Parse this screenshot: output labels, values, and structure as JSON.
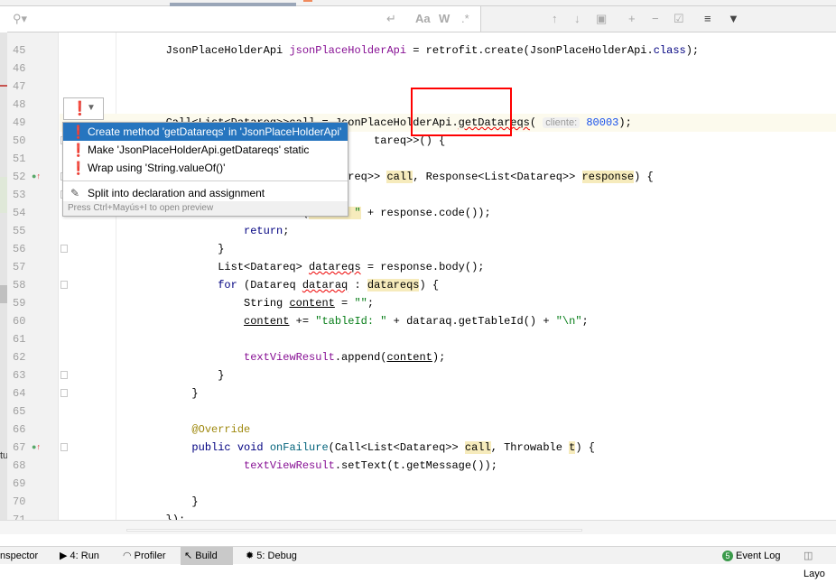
{
  "editor": {
    "lines": [
      {
        "n": "45",
        "segs": [
          [
            "        JsonPlaceHolderApi ",
            ""
          ],
          [
            "jsonPlaceHolderApi",
            "fld"
          ],
          [
            " = retrofit.create(JsonPlaceHolderApi.",
            ""
          ],
          [
            "class",
            "kw"
          ],
          [
            ");",
            ""
          ]
        ]
      },
      {
        "n": "46",
        "segs": []
      },
      {
        "n": "47",
        "segs": []
      },
      {
        "n": "48",
        "segs": []
      },
      {
        "n": "49",
        "cur": true,
        "segs": [
          [
            "        Call<List<Datareq>>call = JsonPlaceHolderApi.",
            ""
          ],
          [
            "getDatareqs",
            "err"
          ],
          [
            "( ",
            ""
          ],
          [
            "cliente:",
            "hint"
          ],
          [
            " ",
            ""
          ],
          [
            "80003",
            "num"
          ],
          [
            ");",
            ""
          ]
        ]
      },
      {
        "n": "50",
        "segs": [
          [
            "                                        tareq>>() {",
            ""
          ]
        ]
      },
      {
        "n": "51",
        "segs": []
      },
      {
        "n": "52",
        "segs": [
          [
            "                            ist<Datareq>> ",
            ""
          ],
          [
            "call",
            "hl"
          ],
          [
            ", Response<List<Datareq>> ",
            ""
          ],
          [
            "response",
            "hl"
          ],
          [
            ") {",
            ""
          ]
        ]
      },
      {
        "n": "53",
        "segs": [
          [
            "                            l()) {",
            ""
          ]
        ]
      },
      {
        "n": "54",
        "segs": [
          [
            "                            t(",
            ""
          ],
          [
            "\"Code: \"",
            "str hl"
          ],
          [
            " + response.code());",
            ""
          ]
        ]
      },
      {
        "n": "55",
        "segs": [
          [
            "                    ",
            ""
          ],
          [
            "return",
            "kw"
          ],
          [
            ";",
            ""
          ]
        ]
      },
      {
        "n": "56",
        "segs": [
          [
            "                }",
            ""
          ]
        ]
      },
      {
        "n": "57",
        "segs": [
          [
            "                List<Datareq> ",
            ""
          ],
          [
            "datareqs",
            "err"
          ],
          [
            " = response.body();",
            ""
          ]
        ]
      },
      {
        "n": "58",
        "segs": [
          [
            "                ",
            ""
          ],
          [
            "for",
            "kw"
          ],
          [
            " (Datareq ",
            ""
          ],
          [
            "dataraq",
            "err"
          ],
          [
            " : ",
            ""
          ],
          [
            "datareqs",
            "hl"
          ],
          [
            ") {",
            ""
          ]
        ]
      },
      {
        "n": "59",
        "segs": [
          [
            "                    String ",
            ""
          ],
          [
            "content",
            "ul"
          ],
          [
            " = ",
            ""
          ],
          [
            "\"\"",
            "str"
          ],
          [
            ";",
            ""
          ]
        ]
      },
      {
        "n": "60",
        "segs": [
          [
            "                    ",
            ""
          ],
          [
            "content",
            "ul"
          ],
          [
            " += ",
            ""
          ],
          [
            "\"tableId: \"",
            "str"
          ],
          [
            " + dataraq.getTableId() + ",
            ""
          ],
          [
            "\"\\n\"",
            "str"
          ],
          [
            ";",
            ""
          ]
        ]
      },
      {
        "n": "61",
        "segs": []
      },
      {
        "n": "62",
        "segs": [
          [
            "                    ",
            ""
          ],
          [
            "textViewResult",
            "fld"
          ],
          [
            ".append(",
            ""
          ],
          [
            "content",
            "ul"
          ],
          [
            ");",
            ""
          ]
        ]
      },
      {
        "n": "63",
        "segs": [
          [
            "                }",
            ""
          ]
        ]
      },
      {
        "n": "64",
        "segs": [
          [
            "            }",
            ""
          ]
        ]
      },
      {
        "n": "65",
        "segs": []
      },
      {
        "n": "66",
        "segs": [
          [
            "            ",
            ""
          ],
          [
            "@Override",
            "ann"
          ]
        ]
      },
      {
        "n": "67",
        "segs": [
          [
            "            ",
            ""
          ],
          [
            "public void",
            "kw"
          ],
          [
            " ",
            ""
          ],
          [
            "onFailure",
            "fn"
          ],
          [
            "(Call<List<Datareq>> ",
            ""
          ],
          [
            "call",
            "hl"
          ],
          [
            ", Throwable ",
            ""
          ],
          [
            "t",
            "hl"
          ],
          [
            ") {",
            ""
          ]
        ]
      },
      {
        "n": "68",
        "segs": [
          [
            "                    ",
            ""
          ],
          [
            "textViewResult",
            "fld"
          ],
          [
            ".setText(t.getMessage());",
            ""
          ]
        ]
      },
      {
        "n": "69",
        "segs": []
      },
      {
        "n": "70",
        "segs": [
          [
            "            }",
            ""
          ]
        ]
      },
      {
        "n": "71",
        "segs": [
          [
            "        });",
            ""
          ]
        ]
      }
    ]
  },
  "popup": {
    "items": [
      {
        "label": "Create method 'getDatareqs' in 'JsonPlaceHolderApi'",
        "icon": "error-bulb-icon",
        "selected": true
      },
      {
        "label": "Make 'JsonPlaceHolderApi.getDatareqs' static",
        "icon": "error-bulb-icon"
      },
      {
        "label": "Wrap using 'String.valueOf()'",
        "icon": "error-bulb-icon"
      }
    ],
    "extra": {
      "label": "Split into declaration and assignment",
      "icon": "pencil-icon"
    },
    "footer": "Press Ctrl+Mayús+I to open preview"
  },
  "bottombar": {
    "inspector": "nspector",
    "run": "4: Run",
    "profiler": "Profiler",
    "build": "Build",
    "debug": "5: Debug",
    "event_count": "5",
    "event_log": "Event Log",
    "layout": "Layo"
  },
  "side_text": "tu",
  "colors": {
    "accent": "#2675bf",
    "error_box": "#ff0000",
    "highlight": "#f6ebbc"
  }
}
